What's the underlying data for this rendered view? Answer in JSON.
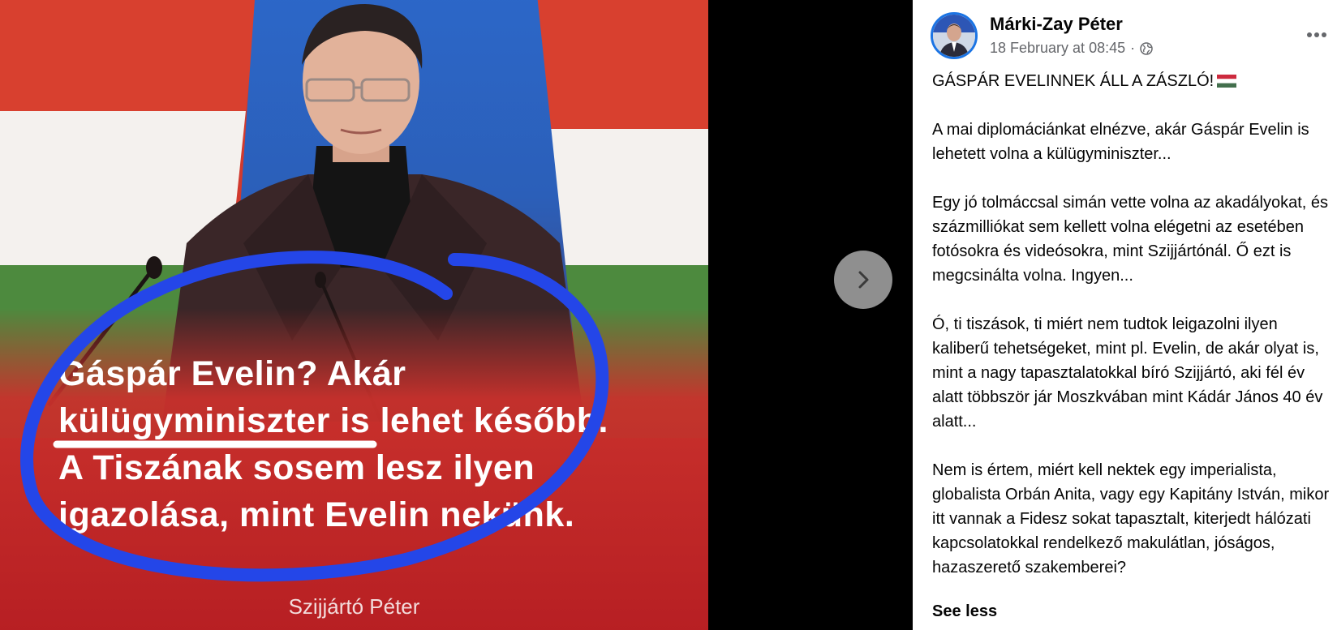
{
  "post": {
    "author_name": "Márki-Zay Péter",
    "timestamp": "18 February at 08:45",
    "separator": "·",
    "title": "GÁSPÁR EVELINNEK ÁLL A ZÁSZLÓ!",
    "paragraphs": [
      "A mai diplomáciánkat elnézve, akár Gáspár Evelin is lehetett volna a külügyminiszter...",
      "Egy jó tolmáccsal simán vette volna az akadályokat, és százmilliókat sem kellett volna elégetni az esetében fotósokra és videósokra, mint Szijjártónál. Ő ezt is megcsinálta volna. Ingyen...",
      "Ó, ti tiszások, ti miért nem tudtok leigazolni ilyen kaliberű tehetségeket, mint pl. Evelin, de akár olyat is, mint a nagy tapasztalatokkal bíró Szijjártó, aki fél év alatt többször jár Moszkvában mint Kádár János 40 év alatt...",
      "Nem is értem, miért kell nektek egy imperialista, globalista Orbán Anita, vagy egy Kapitány István, mikor itt vannak a Fidesz sokat tapasztalt, kiterjedt hálózati kapcsolatokkal rendelkező makulátlan, jóságos, hazaszerető szakemberei?"
    ],
    "see_less_label": "See less"
  },
  "image": {
    "caption_lines": [
      "Gáspár Evelin? Akár",
      "külügyminiszter is lehet később.",
      "A Tiszának sosem lesz ilyen",
      "igazolása, mint Evelin nekünk."
    ],
    "caption_author": "Szijjártó Péter"
  },
  "icons": {
    "privacy": "globe-icon",
    "more": "more-options-icon",
    "next": "chevron-right-icon",
    "flag": "hungary-flag-icon"
  },
  "colors": {
    "annotation_blue": "#2446e8",
    "privacy_grey": "#65676b",
    "avatar_ring": "#1b74e4"
  }
}
